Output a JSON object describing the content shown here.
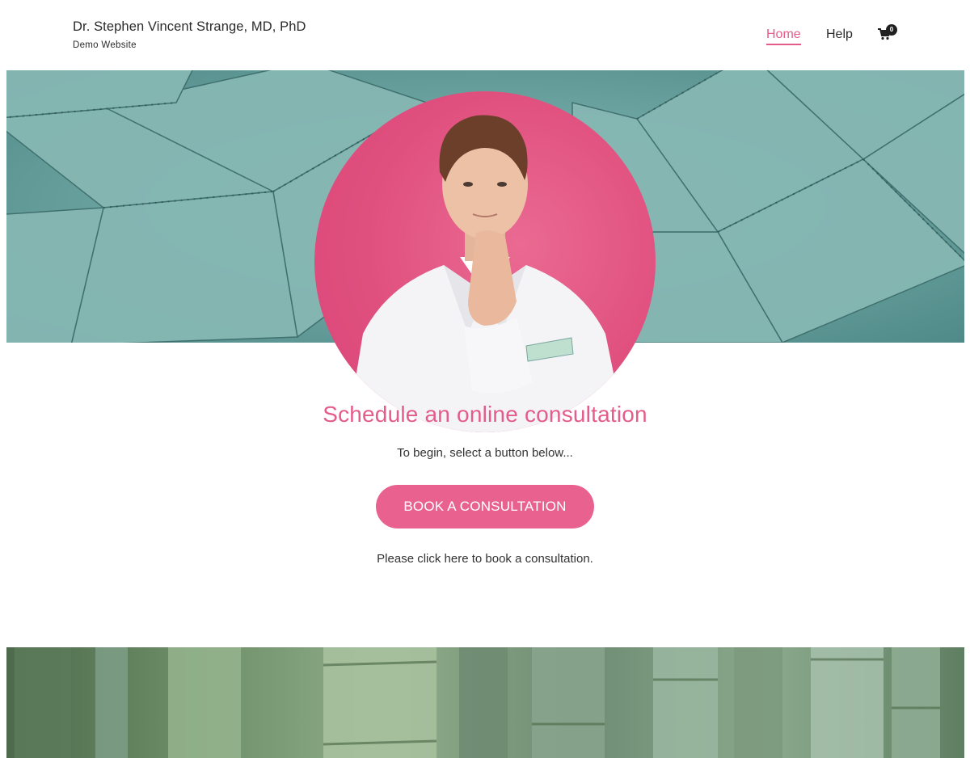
{
  "header": {
    "title": "Dr. Stephen Vincent Strange, MD, PhD",
    "subtitle": "Demo Website",
    "nav": {
      "home_label": "Home",
      "help_label": "Help"
    },
    "cart": {
      "icon": "cart-icon",
      "count": "0"
    }
  },
  "main": {
    "heading": "Schedule an online consultation",
    "intro_text": "To begin, select a button below...",
    "book_button_label": "BOOK A CONSULTATION",
    "note_text": "Please click here to book a consultation."
  },
  "colors": {
    "accent": "#e45c89",
    "button": "#e9628f",
    "text": "#333333"
  }
}
